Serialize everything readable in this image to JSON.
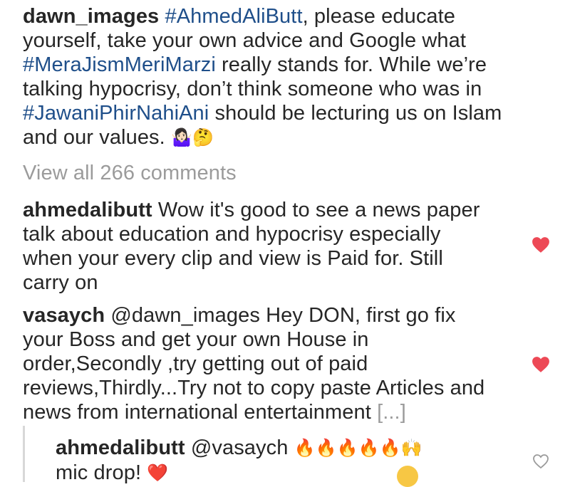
{
  "caption": {
    "username": "dawn_images",
    "segments": [
      {
        "text": "#AhmedAliButt",
        "tag": true
      },
      {
        "text": ", please educate yourself, take your own advice and Google what ",
        "tag": false
      },
      {
        "text": "#MeraJismMeriMarzi",
        "tag": true
      },
      {
        "text": " really stands for. While we’re talking hypocrisy, don’t think someone who was in ",
        "tag": false
      },
      {
        "text": "#JawaniPhirNahiAni",
        "tag": true
      },
      {
        "text": " should be lecturing us on Islam and our values. ",
        "tag": false
      }
    ],
    "emojis": "🤷🏻‍♀️🤔"
  },
  "view_all_comments": "View all 266 comments",
  "comments": [
    {
      "username": "ahmedalibutt",
      "text": "Wow it's good to see a news paper talk about education and hypocrisy especially when your every clip and view is Paid for. Still carry on",
      "liked": true
    },
    {
      "username": "vasaych",
      "text": "@dawn_images Hey DON, first go fix your Boss and get your own House in order,Secondly ,try getting out of paid reviews,Thirdly...Try not to copy paste Articles and news from international entertainment",
      "more": "[...]",
      "liked": true
    }
  ],
  "reply": {
    "username": "ahmedalibutt",
    "mention": "@vasaych",
    "emojis": "🔥🔥🔥🔥🔥🙌",
    "text2": "mic drop!",
    "emoji2": "❤️",
    "liked": false
  },
  "colors": {
    "like_red": "#ed4956",
    "hashtag_blue": "#1f4f8a",
    "muted_gray": "#9b9b9b"
  },
  "icons": {
    "liked": "heart-filled-icon",
    "unliked": "heart-outline-icon"
  }
}
